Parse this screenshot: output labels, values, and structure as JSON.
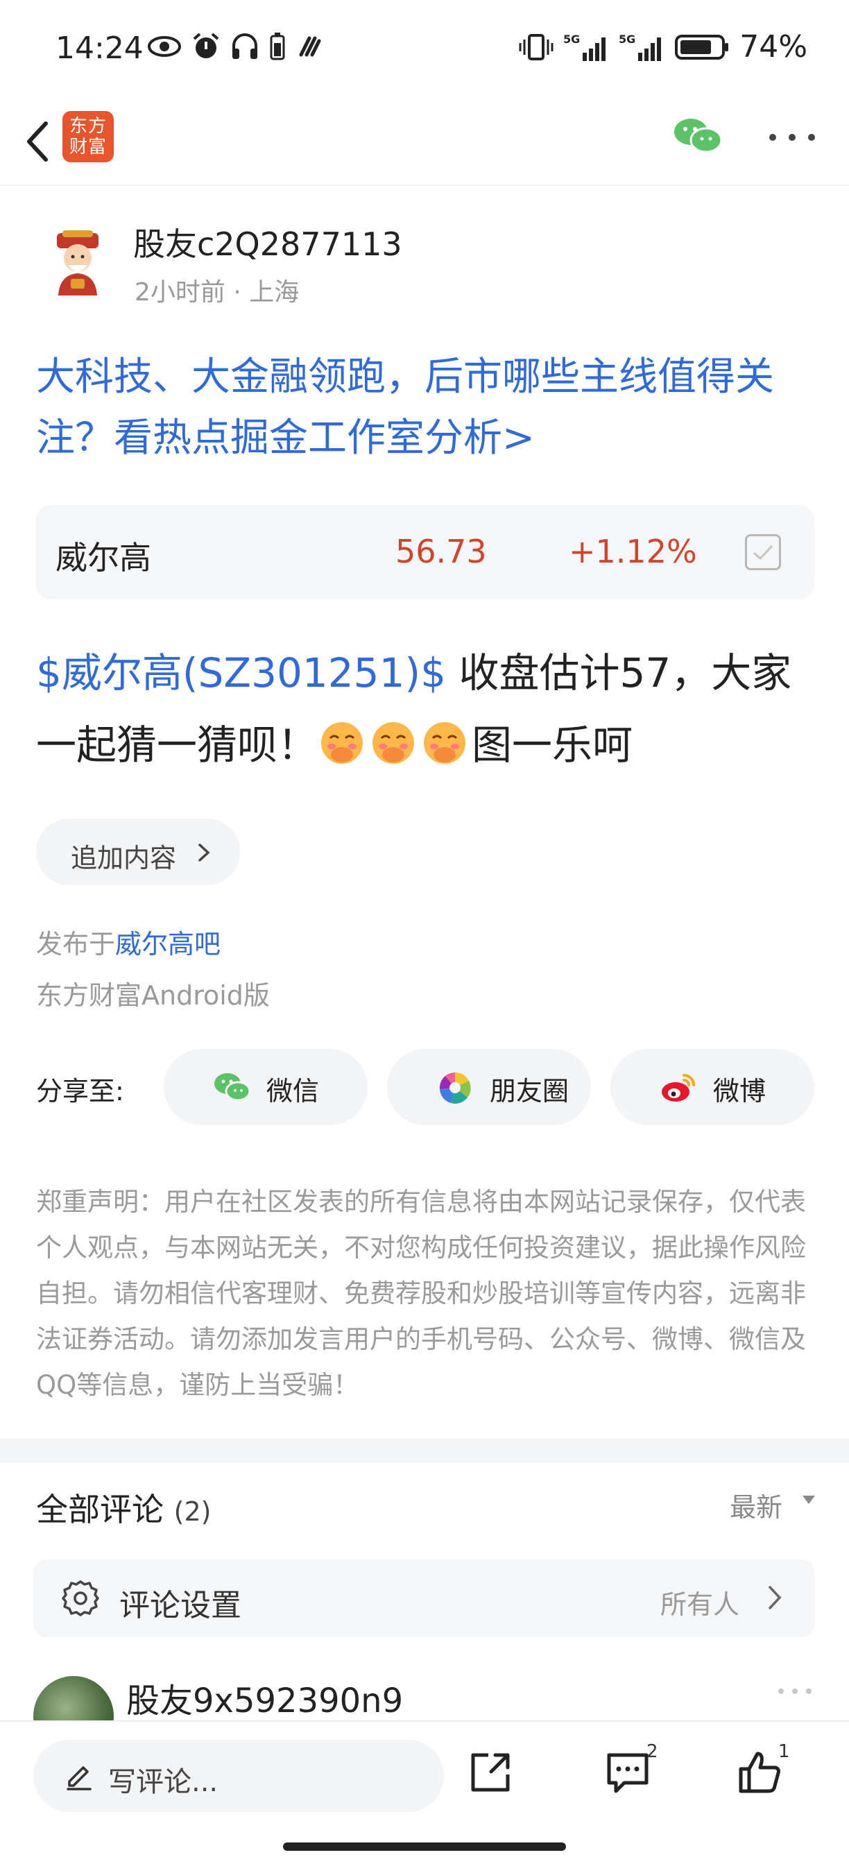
{
  "status_bar": {
    "time": "14:24",
    "battery_percent": "74%",
    "left_icons": [
      "eye-icon",
      "alarm-icon",
      "headphones-icon",
      "battery-saver-icon",
      "nfc-icon"
    ],
    "right_icons": [
      "vibrate-icon",
      "signal-5g-icon",
      "signal-5g-icon",
      "battery-icon"
    ]
  },
  "nav": {
    "logo_text": "东方财富",
    "logo_color": "#e8542b"
  },
  "author": {
    "name": "股友c2Q2877113",
    "meta": "2小时前 · 上海"
  },
  "promo_link": "大科技、大金融领跑，后市哪些主线值得关注？看热点掘金工作室分析>",
  "stock": {
    "name": "威尔高",
    "price": "56.73",
    "change": "+1.12%",
    "price_color": "#d1442c"
  },
  "post": {
    "tag": "$威尔高(SZ301251)$",
    "text_before_emoji": " 收盘估计57，大家一起猜一猜呗！",
    "emoji_count": 3,
    "text_after_emoji": "图一乐呵"
  },
  "add_content_label": "追加内容",
  "published": {
    "prefix": "发布于",
    "bar": "威尔高吧",
    "client": "东方财富Android版"
  },
  "share": {
    "label": "分享至:",
    "targets": [
      {
        "label": "微信",
        "icon": "wechat-icon"
      },
      {
        "label": "朋友圈",
        "icon": "moments-icon"
      },
      {
        "label": "微博",
        "icon": "weibo-icon"
      }
    ]
  },
  "disclaimer": "郑重声明：用户在社区发表的所有信息将由本网站记录保存，仅代表个人观点，与本网站无关，不对您构成任何投资建议，据此操作风险自担。请勿相信代客理财、免费荐股和炒股培训等宣传内容，远离非法证券活动。请勿添加发言用户的手机号码、公众号、微博、微信及QQ等信息，谨防上当受骗！",
  "comments": {
    "title": "全部评论",
    "count": "(2)",
    "sort": "最新",
    "settings_label": "评论设置",
    "settings_value": "所有人",
    "first_commenter": "股友9x592390n9"
  },
  "bottom_bar": {
    "write_placeholder": "写评论...",
    "comment_count": "2",
    "like_count": "1"
  }
}
